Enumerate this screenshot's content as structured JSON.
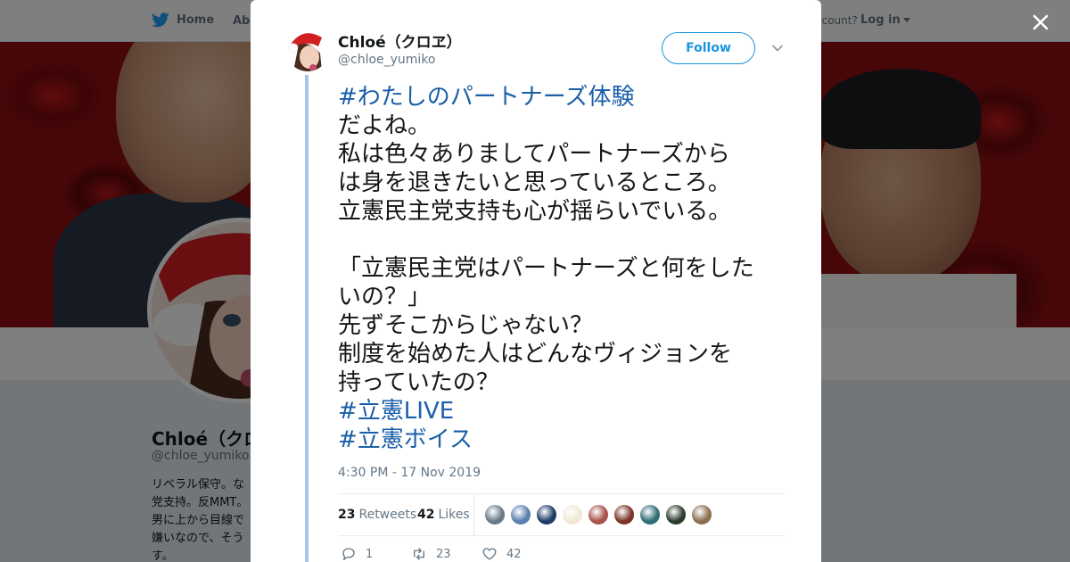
{
  "nav": {
    "home_label": "Home",
    "about_label": "Abo",
    "account_text": "ccount?",
    "login_label": "Log in"
  },
  "profile": {
    "name": "Chloé（クロ",
    "handle": "@chloe_yumiko",
    "bio_lines": [
      "リベラル保守。な",
      "党支持。反MMT。",
      "男に上から目線で",
      "嫌いなので、そう",
      "す。"
    ]
  },
  "modal": {
    "close_label": "✕"
  },
  "tweet": {
    "author_name": "Chloé（クロヱ）",
    "author_handle": "@chloe_yumiko",
    "follow_label": "Follow",
    "text_lines": [
      {
        "text": "#わたしのパートナーズ体験",
        "is_tag": true
      },
      {
        "text": "だよね。",
        "is_tag": false
      },
      {
        "text": "私は色々ありましてパートナーズから",
        "is_tag": false
      },
      {
        "text": "は身を退きたいと思っているところ。",
        "is_tag": false
      },
      {
        "text": "立憲民主党支持も心が揺らいでいる。",
        "is_tag": false
      },
      {
        "text": "",
        "is_tag": false
      },
      {
        "text": "「立憲民主党はパートナーズと何をした",
        "is_tag": false
      },
      {
        "text": "いの？」",
        "is_tag": false
      },
      {
        "text": "先ずそこからじゃない？",
        "is_tag": false
      },
      {
        "text": "制度を始めた人はどんなヴィジョンを",
        "is_tag": false
      },
      {
        "text": "持っていたの？",
        "is_tag": false
      },
      {
        "text": "#立憲LIVE",
        "is_tag": true
      },
      {
        "text": "#立憲ボイス",
        "is_tag": true
      }
    ],
    "timestamp": "4:30 PM - 17 Nov 2019",
    "retweets_count": "23",
    "retweets_label": "Retweets",
    "likes_count": "42",
    "likes_label": "Likes",
    "liker_colors": [
      "#6b7a86",
      "#5a7fb0",
      "#1e3c66",
      "#efe8d4",
      "#a8524a",
      "#7a3324",
      "#2f6e77",
      "#2c3b2c",
      "#8a6f4e"
    ],
    "actions": {
      "reply_count": "1",
      "retweet_count": "23",
      "like_count": "42"
    }
  },
  "colors": {
    "accent": "#1b95e0",
    "hashtag": "#1b5fa8",
    "thread_line": "#a5c6e8"
  }
}
